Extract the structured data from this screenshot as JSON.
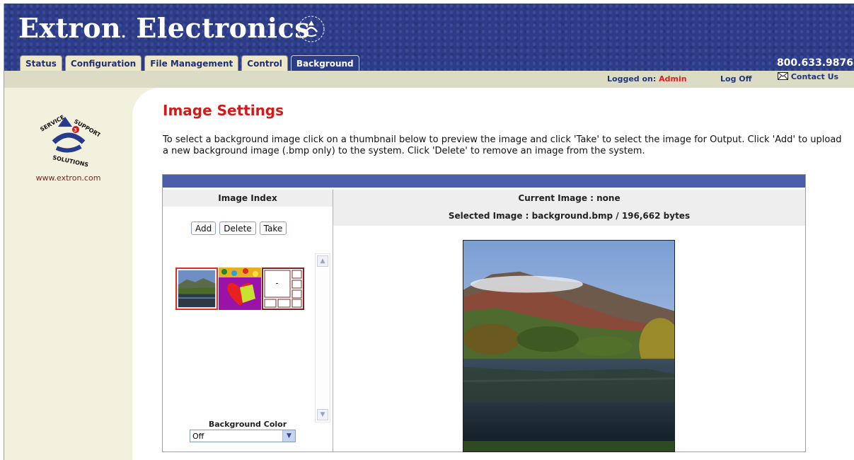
{
  "header": {
    "brand_main": "Extron",
    "brand_dot": ".",
    "brand_second": "Electronics",
    "phone": "800.633.9876",
    "tabs": [
      {
        "label": "Status"
      },
      {
        "label": "Configuration"
      },
      {
        "label": "File Management"
      },
      {
        "label": "Control"
      },
      {
        "label": "Background"
      }
    ],
    "active_tab": "Background"
  },
  "statusbar": {
    "logged_on_label": "Logged on:",
    "user": "Admin",
    "log_off": "Log Off",
    "contact_us": "Contact Us",
    "contact_icon": "envelope-icon"
  },
  "sidebar": {
    "logo_icon": "service-support-solutions-logo",
    "url": "www.extron.com"
  },
  "main": {
    "title": "Image Settings",
    "description": "To select a background image click on a thumbnail below to preview the image and click 'Take' to select the image for Output. Click 'Add' to upload a new background image (.bmp only) to the system. Click 'Delete' to remove an image from the system."
  },
  "image_index": {
    "heading": "Image Index",
    "buttons": {
      "add": "Add",
      "delete": "Delete",
      "take": "Take"
    },
    "thumbnails": [
      {
        "name": "landscape-thumbnail",
        "selected": true
      },
      {
        "name": "colorful-heart-thumbnail",
        "selected": false
      },
      {
        "name": "grid-layout-thumbnail",
        "selected": false
      }
    ],
    "background_color_label": "Background Color",
    "background_color_value": "Off"
  },
  "preview": {
    "current_image": "Current Image : none",
    "selected_image": "Selected Image : background.bmp / 196,662 bytes"
  },
  "colors": {
    "header_bg": "#2d3c86",
    "tab_bg": "#efe8c8",
    "title_red": "#d11a1a",
    "panel_bar": "#4a5ea8",
    "sidebar_bg": "#f2f1dd"
  }
}
